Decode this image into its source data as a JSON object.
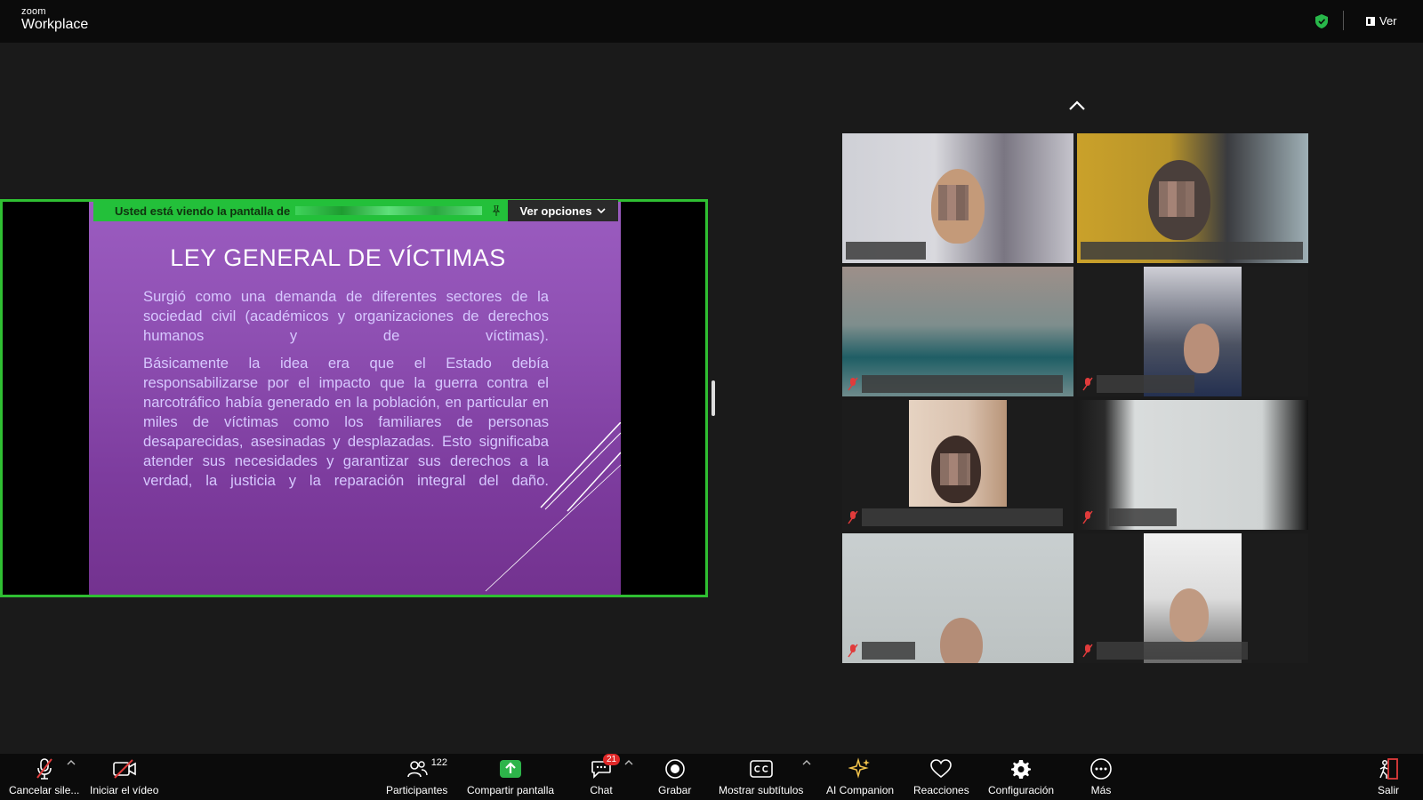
{
  "app": {
    "brand_small": "zoom",
    "brand_big": "Workplace"
  },
  "topbar": {
    "view_label": "Ver"
  },
  "share": {
    "banner_text": "Usted está viendo la pantalla de",
    "options_label": "Ver opciones"
  },
  "slide": {
    "title": "LEY GENERAL DE VÍCTIMAS",
    "paragraph1": "Surgió como una demanda de diferentes sectores de la sociedad civil (académicos y organizaciones de derechos humanos y de víctimas).",
    "paragraph2": "Básicamente la idea era que el Estado debía responsabilizarse por el impacto que la guerra contra el narcotráfico había generado en la población, en particular en miles de víctimas como los familiares de personas desaparecidas, asesinadas y desplazadas. Esto significaba atender sus necesidades y garantizar sus derechos a la verdad, la justicia y la reparación integral del daño."
  },
  "toolbar": {
    "mute_label": "Cancelar sile...",
    "video_label": "Iniciar el vídeo",
    "participants_label": "Participantes",
    "participants_count": "122",
    "share_label": "Compartir pantalla",
    "chat_label": "Chat",
    "chat_badge": "21",
    "record_label": "Grabar",
    "captions_label": "Mostrar subtítulos",
    "ai_label": "AI Companion",
    "reactions_label": "Reacciones",
    "settings_label": "Configuración",
    "more_label": "Más",
    "leave_label": "Salir"
  },
  "colors": {
    "share_border": "#2fbf32",
    "banner_green": "#23c03a",
    "slide_purple": "#8e4fb2",
    "slide_text": "#d7c8ff",
    "mute_red": "#e03b3b",
    "share_button_green": "#2db44a",
    "chat_badge_red": "#e02828"
  },
  "icons": [
    "shield-icon",
    "gallery-view-icon",
    "microphone-muted-icon",
    "video-off-icon",
    "participants-icon",
    "share-screen-icon",
    "chat-icon",
    "record-icon",
    "captions-icon",
    "ai-companion-icon",
    "reactions-icon",
    "settings-icon",
    "more-icon",
    "leave-icon",
    "chevron-up-icon"
  ]
}
